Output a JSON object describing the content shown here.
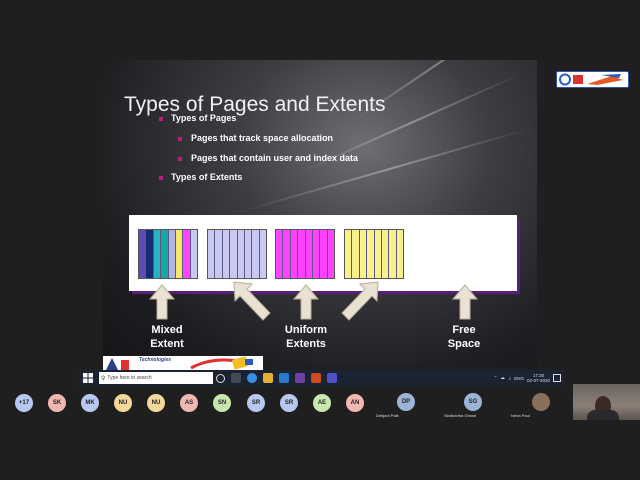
{
  "slide": {
    "title": "Types of Pages and Extents",
    "bullets": [
      {
        "text": "Types of Pages"
      },
      {
        "text": "Pages that track space allocation"
      },
      {
        "text": "Pages that contain user and index data"
      },
      {
        "text": "Types of Extents"
      }
    ],
    "labels": {
      "mixed": [
        "Mixed",
        "Extent"
      ],
      "uniform": [
        "Uniform",
        "Extents"
      ],
      "free": [
        "Free",
        "Space"
      ]
    },
    "extent_colors": {
      "mixed": [
        "#5a4fb0",
        "#1a2a6e",
        "#27b4c0",
        "#1aa6a0",
        "#b3b3e8",
        "#f5e86a",
        "#ff44ff",
        "#c9c9f0"
      ],
      "uniform_lavender": "#c8c8f0",
      "uniform_magenta": "#ff44ff",
      "uniform_yellow": "#f8f08a"
    }
  },
  "logo": {
    "small_text": "Technologies"
  },
  "taskbar": {
    "search_placeholder": "Type here to search",
    "lang": "ENG",
    "time": "17:30",
    "date": "02-07-2020"
  },
  "participants": [
    {
      "initials": "+17",
      "color": "#b8c8f0"
    },
    {
      "initials": "SK",
      "color": "#f0b8b0"
    },
    {
      "initials": "MK",
      "color": "#b8c8f0"
    },
    {
      "initials": "NU",
      "color": "#f5d89a"
    },
    {
      "initials": "NU",
      "color": "#f5d89a"
    },
    {
      "initials": "AS",
      "color": "#f0b8b0"
    },
    {
      "initials": "SN",
      "color": "#c8e8b0"
    },
    {
      "initials": "SR",
      "color": "#b8c8f0"
    },
    {
      "initials": "SR",
      "color": "#b8c8f0"
    },
    {
      "initials": "AE",
      "color": "#c8e8b0"
    },
    {
      "initials": "AN",
      "color": "#f0b8b0"
    }
  ],
  "camera_participants": [
    {
      "initials": "DP",
      "name": "Debjani Palit"
    },
    {
      "initials": "SG",
      "name": "Siddhartha Ghosh"
    },
    {
      "initials": "",
      "name": "Neha Paul"
    }
  ]
}
